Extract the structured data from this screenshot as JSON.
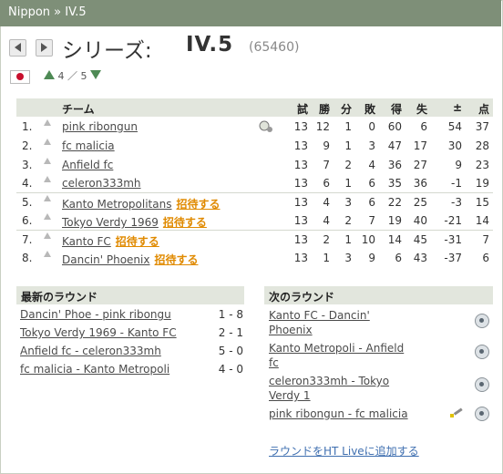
{
  "breadcrumb": "Nippon » IV.5",
  "header": {
    "series_label": "シリーズ:",
    "series_name": "IV.5",
    "series_id": "(65460)",
    "rank_current": "4",
    "rank_sep": "／",
    "rank_total": "5"
  },
  "table": {
    "columns": [
      "チーム",
      "試",
      "勝",
      "分",
      "敗",
      "得",
      "失",
      "±",
      "点"
    ],
    "invite_label": "招待する",
    "rows": [
      {
        "pos": "1.",
        "team": "pink ribongun",
        "invite": false,
        "gp": "13",
        "w": "12",
        "d": "1",
        "l": "0",
        "gf": "60",
        "ga": "6",
        "diff": "54",
        "pts": "37"
      },
      {
        "pos": "2.",
        "team": "fc malicia",
        "invite": false,
        "gp": "13",
        "w": "9",
        "d": "1",
        "l": "3",
        "gf": "47",
        "ga": "17",
        "diff": "30",
        "pts": "28"
      },
      {
        "pos": "3.",
        "team": "Anfield fc",
        "invite": false,
        "gp": "13",
        "w": "7",
        "d": "2",
        "l": "4",
        "gf": "36",
        "ga": "27",
        "diff": "9",
        "pts": "23"
      },
      {
        "pos": "4.",
        "team": "celeron333mh",
        "invite": false,
        "gp": "13",
        "w": "6",
        "d": "1",
        "l": "6",
        "gf": "35",
        "ga": "36",
        "diff": "-1",
        "pts": "19"
      },
      {
        "pos": "5.",
        "team": "Kanto Metropolitans",
        "invite": true,
        "gp": "13",
        "w": "4",
        "d": "3",
        "l": "6",
        "gf": "22",
        "ga": "25",
        "diff": "-3",
        "pts": "15"
      },
      {
        "pos": "6.",
        "team": "Tokyo Verdy 1969",
        "invite": true,
        "gp": "13",
        "w": "4",
        "d": "2",
        "l": "7",
        "gf": "19",
        "ga": "40",
        "diff": "-21",
        "pts": "14"
      },
      {
        "pos": "7.",
        "team": "Kanto FC",
        "invite": true,
        "gp": "13",
        "w": "2",
        "d": "1",
        "l": "10",
        "gf": "14",
        "ga": "45",
        "diff": "-31",
        "pts": "7"
      },
      {
        "pos": "8.",
        "team": "Dancin' Phoenix",
        "invite": true,
        "gp": "13",
        "w": "1",
        "d": "3",
        "l": "9",
        "gf": "6",
        "ga": "43",
        "diff": "-37",
        "pts": "6"
      }
    ]
  },
  "latest_round": {
    "title": "最新のラウンド",
    "matches": [
      {
        "teams": "Dancin' Phoe - pink ribongu",
        "score": "1 - 8"
      },
      {
        "teams": "Tokyo Verdy 1969 - Kanto FC",
        "score": "2 - 1"
      },
      {
        "teams": "Anfield fc - celeron333mh",
        "score": "5 - 0"
      },
      {
        "teams": "fc malicia - Kanto Metropoli",
        "score": "4 - 0"
      }
    ]
  },
  "next_round": {
    "title": "次のラウンド",
    "matches": [
      {
        "line1": "Kanto FC - Dancin'",
        "line2": "Phoenix"
      },
      {
        "line1": "Kanto Metropoli - Anfield",
        "line2": "fc"
      },
      {
        "line1": "celeron333mh - Tokyo",
        "line2": "Verdy 1"
      },
      {
        "line1": "pink ribongun - fc malicia",
        "line2": ""
      }
    ],
    "add_live_label": "ラウンドをHT Liveに追加する"
  }
}
